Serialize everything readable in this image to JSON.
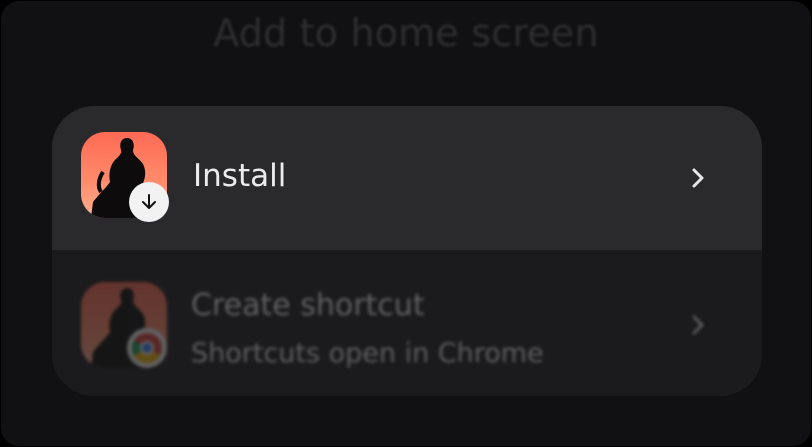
{
  "dialog": {
    "title": "Add to home screen"
  },
  "options": {
    "install": {
      "label": "Install",
      "icon": "app-icon-silhouette",
      "badge_icon": "download-arrow-icon",
      "trailing_icon": "chevron-right-icon"
    },
    "shortcut": {
      "label": "Create shortcut",
      "sublabel": "Shortcuts open in Chrome",
      "icon": "app-icon-silhouette",
      "badge_icon": "chrome-icon",
      "trailing_icon": "chevron-right-icon"
    }
  },
  "colors": {
    "sheet_bg": "#111113",
    "card_bg": "#1b1b1d",
    "row_highlight": "#2a2a2d",
    "icon_gradient_top": "#ff6a55",
    "icon_gradient_bottom": "#ffb08f",
    "text": "#ececec"
  }
}
